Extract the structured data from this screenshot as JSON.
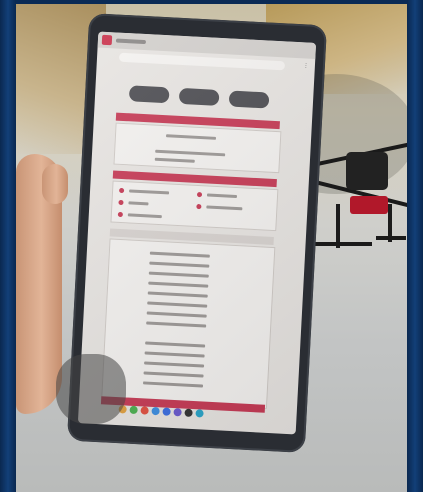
{
  "photo": {
    "colors": {
      "frame": "#0d2c56",
      "accent": "#c63a55",
      "drone_red": "#b1182a"
    }
  }
}
